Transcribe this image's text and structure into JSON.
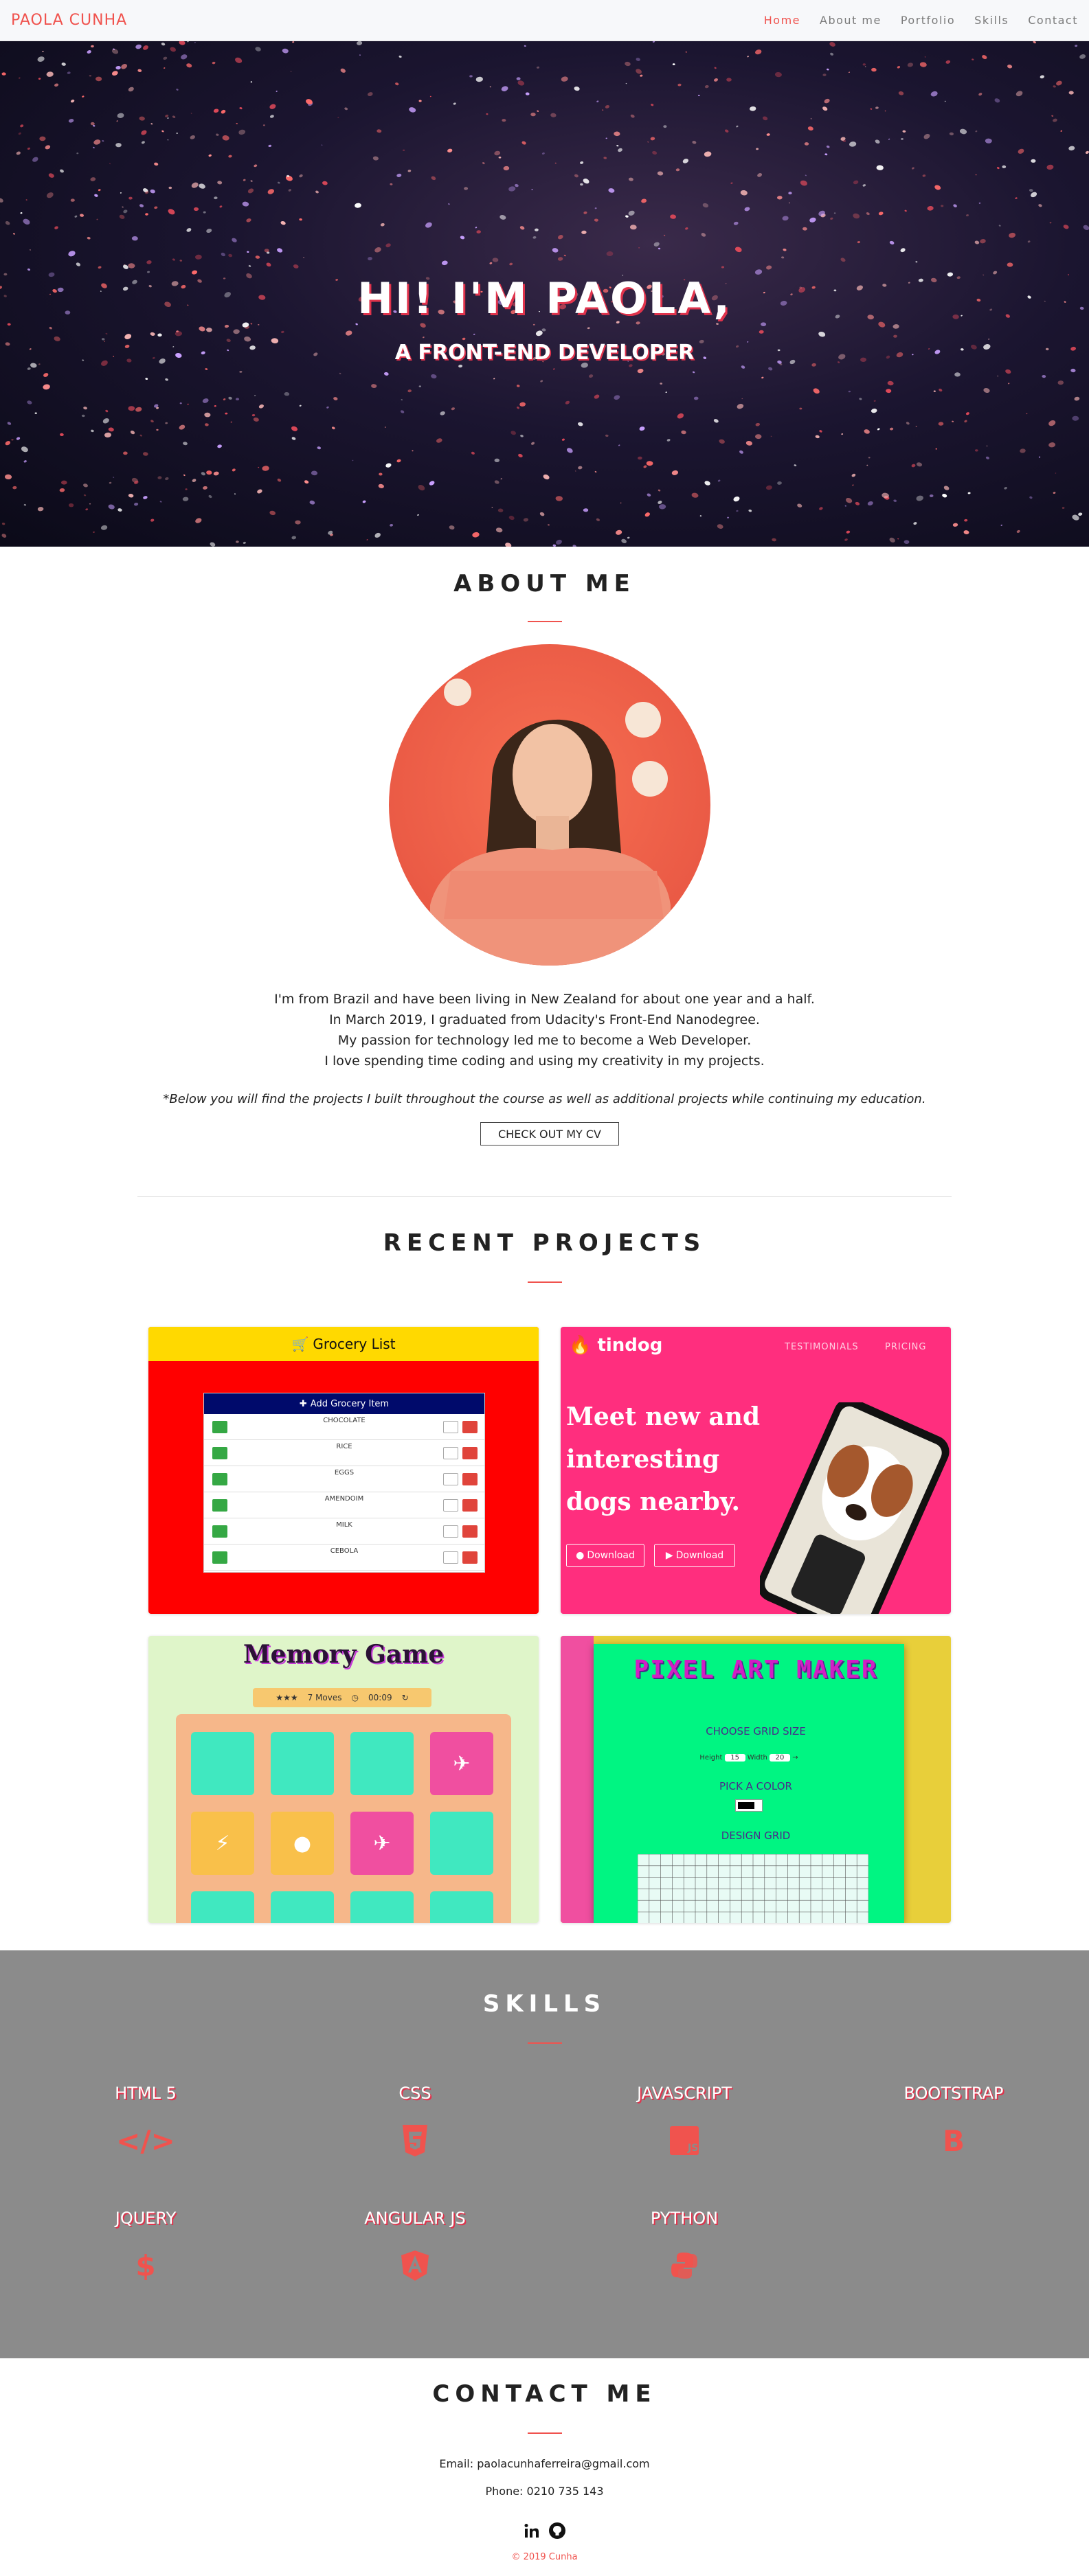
{
  "nav": {
    "brand": "PAOLA CUNHA",
    "links": [
      "Home",
      "About me",
      "Portfolio",
      "Skills",
      "Contact"
    ]
  },
  "hero": {
    "title": "HI! I'M PAOLA,",
    "subtitle": "A FRONT-END DEVELOPER"
  },
  "about": {
    "heading": "ABOUT ME",
    "lines": [
      "I'm from Brazil and have been living in New Zealand for about one year and a half.",
      "In March 2019, I graduated from Udacity's Front-End Nanodegree.",
      "My passion for technology led me to become a Web Developer.",
      "I love spending time coding and using my creativity in my projects."
    ],
    "note": "*Below you will find the projects I built throughout the course as well as additional projects while continuing my education.",
    "cv_button": "CHECK OUT MY CV"
  },
  "projects": {
    "heading": "RECENT PROJECTS",
    "grocery": {
      "title": "Grocery List",
      "panel_title": "Add Grocery Item",
      "items": [
        "CHOCOLATE",
        "RICE",
        "EGGS",
        "AMENDOIM",
        "MILK",
        "CEBOLA"
      ]
    },
    "tindog": {
      "logo": "tindog",
      "nav": [
        "TESTIMONIALS",
        "PRICING"
      ],
      "headline": "Meet new and interesting dogs nearby.",
      "buttons": [
        "Download",
        "Download"
      ]
    },
    "memory": {
      "title": "Memory Game",
      "stars": "★★★",
      "moves": "7 Moves",
      "time": "00:09"
    },
    "pixel": {
      "title": "PIXEL ART MAKER",
      "grid_size_label": "CHOOSE GRID SIZE",
      "height_label": "Height",
      "height_value": "15",
      "width_label": "Width",
      "width_value": "20",
      "pick_color_label": "PICK A COLOR",
      "design_grid_label": "DESIGN GRID"
    }
  },
  "skills": {
    "heading": "SKILLS",
    "items": [
      {
        "name": "HTML 5",
        "icon": "code-icon"
      },
      {
        "name": "CSS",
        "icon": "css3-icon"
      },
      {
        "name": "JAVASCRIPT",
        "icon": "js-icon"
      },
      {
        "name": "BOOTSTRAP",
        "icon": "bootstrap-icon"
      },
      {
        "name": "JQUERY",
        "icon": "dollar-icon"
      },
      {
        "name": "ANGULAR JS",
        "icon": "angular-icon"
      },
      {
        "name": "PYTHON",
        "icon": "python-icon"
      }
    ],
    "icon_color": "#f0534e"
  },
  "contact": {
    "heading": "CONTACT ME",
    "email": "Email: paolacunhaferreira@gmail.com",
    "phone": "Phone: 0210 735 143",
    "social": [
      "linkedin-icon",
      "github-icon"
    ],
    "footer": "© 2019 Cunha"
  },
  "colors": {
    "accent": "#f0534e",
    "skills_bg": "#8b8b8b"
  }
}
